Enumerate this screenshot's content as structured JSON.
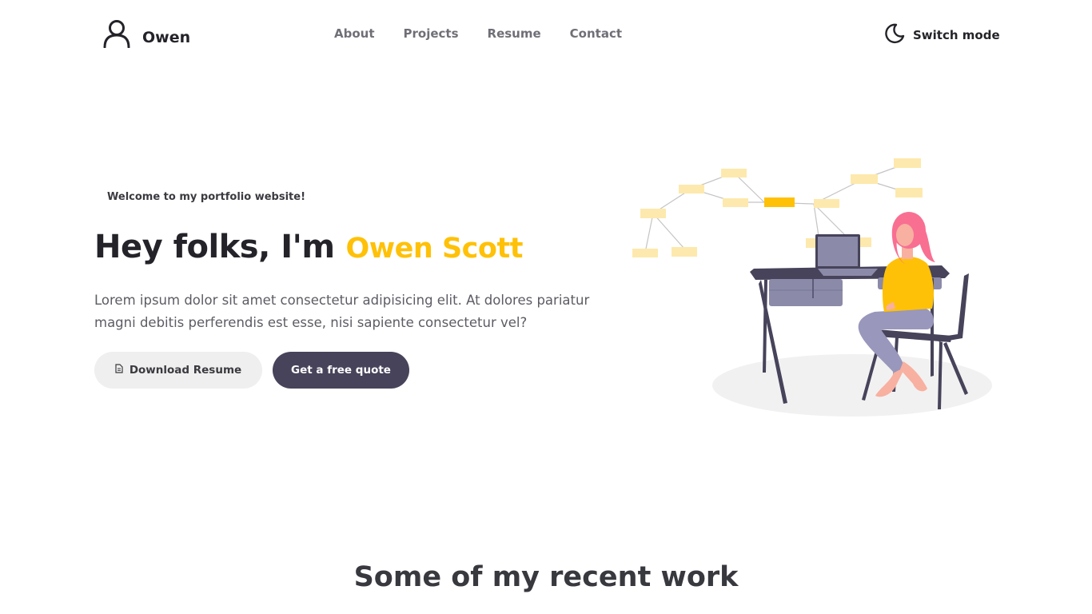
{
  "nav": {
    "brand": {
      "name": "Owen",
      "icon": "user-icon"
    },
    "links": [
      {
        "label": "About"
      },
      {
        "label": "Projects"
      },
      {
        "label": "Resume"
      },
      {
        "label": "Contact"
      }
    ],
    "mode_toggle": {
      "label": "Switch mode",
      "icon": "moon-icon"
    }
  },
  "hero": {
    "welcome": "Welcome to my portfolio website!",
    "greeting": "Hey folks, I'm",
    "name": "Owen Scott",
    "description": "Lorem ipsum dolor sit amet consectetur adipisicing elit. At dolores pariatur magni debitis perferendis est esse, nisi sapiente consectetur vel?",
    "buttons": {
      "resume": {
        "label": "Download Resume",
        "icon": "document-icon"
      },
      "quote": {
        "label": "Get a free quote"
      }
    }
  },
  "recent_work": {
    "title": "Some of my recent work"
  },
  "colors": {
    "accent": "#ffc107",
    "primary_button": "#46435a",
    "secondary_button": "#efefef",
    "text_dark": "#232329"
  }
}
